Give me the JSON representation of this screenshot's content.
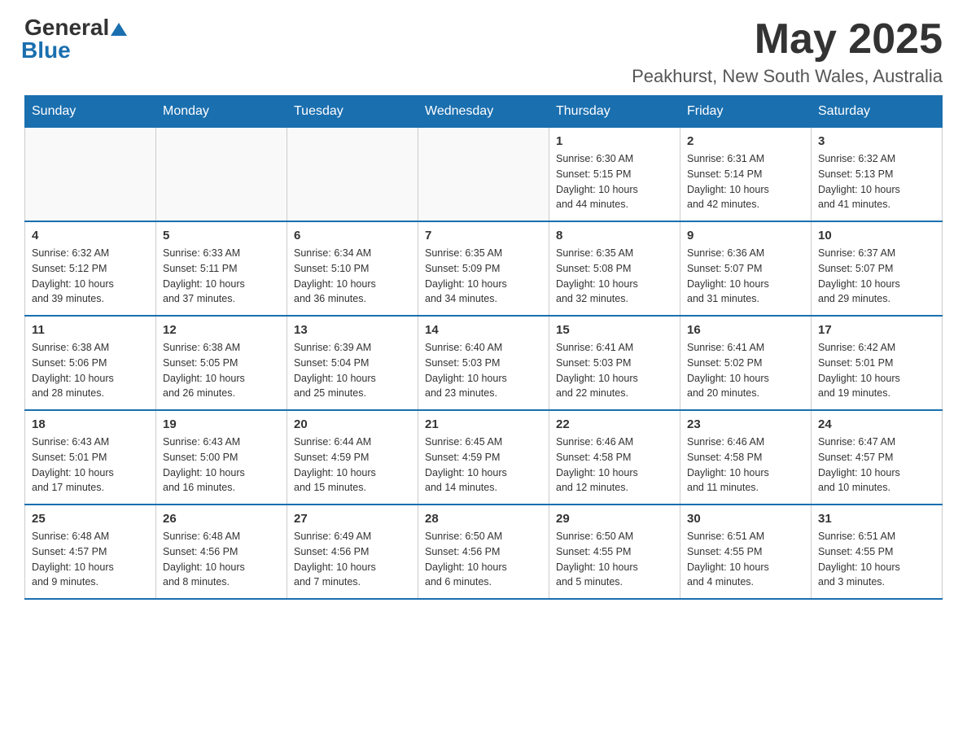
{
  "header": {
    "logo_general": "General",
    "logo_blue": "Blue",
    "month_title": "May 2025",
    "location": "Peakhurst, New South Wales, Australia"
  },
  "days_of_week": [
    "Sunday",
    "Monday",
    "Tuesday",
    "Wednesday",
    "Thursday",
    "Friday",
    "Saturday"
  ],
  "weeks": [
    [
      {
        "day": "",
        "info": ""
      },
      {
        "day": "",
        "info": ""
      },
      {
        "day": "",
        "info": ""
      },
      {
        "day": "",
        "info": ""
      },
      {
        "day": "1",
        "info": "Sunrise: 6:30 AM\nSunset: 5:15 PM\nDaylight: 10 hours\nand 44 minutes."
      },
      {
        "day": "2",
        "info": "Sunrise: 6:31 AM\nSunset: 5:14 PM\nDaylight: 10 hours\nand 42 minutes."
      },
      {
        "day": "3",
        "info": "Sunrise: 6:32 AM\nSunset: 5:13 PM\nDaylight: 10 hours\nand 41 minutes."
      }
    ],
    [
      {
        "day": "4",
        "info": "Sunrise: 6:32 AM\nSunset: 5:12 PM\nDaylight: 10 hours\nand 39 minutes."
      },
      {
        "day": "5",
        "info": "Sunrise: 6:33 AM\nSunset: 5:11 PM\nDaylight: 10 hours\nand 37 minutes."
      },
      {
        "day": "6",
        "info": "Sunrise: 6:34 AM\nSunset: 5:10 PM\nDaylight: 10 hours\nand 36 minutes."
      },
      {
        "day": "7",
        "info": "Sunrise: 6:35 AM\nSunset: 5:09 PM\nDaylight: 10 hours\nand 34 minutes."
      },
      {
        "day": "8",
        "info": "Sunrise: 6:35 AM\nSunset: 5:08 PM\nDaylight: 10 hours\nand 32 minutes."
      },
      {
        "day": "9",
        "info": "Sunrise: 6:36 AM\nSunset: 5:07 PM\nDaylight: 10 hours\nand 31 minutes."
      },
      {
        "day": "10",
        "info": "Sunrise: 6:37 AM\nSunset: 5:07 PM\nDaylight: 10 hours\nand 29 minutes."
      }
    ],
    [
      {
        "day": "11",
        "info": "Sunrise: 6:38 AM\nSunset: 5:06 PM\nDaylight: 10 hours\nand 28 minutes."
      },
      {
        "day": "12",
        "info": "Sunrise: 6:38 AM\nSunset: 5:05 PM\nDaylight: 10 hours\nand 26 minutes."
      },
      {
        "day": "13",
        "info": "Sunrise: 6:39 AM\nSunset: 5:04 PM\nDaylight: 10 hours\nand 25 minutes."
      },
      {
        "day": "14",
        "info": "Sunrise: 6:40 AM\nSunset: 5:03 PM\nDaylight: 10 hours\nand 23 minutes."
      },
      {
        "day": "15",
        "info": "Sunrise: 6:41 AM\nSunset: 5:03 PM\nDaylight: 10 hours\nand 22 minutes."
      },
      {
        "day": "16",
        "info": "Sunrise: 6:41 AM\nSunset: 5:02 PM\nDaylight: 10 hours\nand 20 minutes."
      },
      {
        "day": "17",
        "info": "Sunrise: 6:42 AM\nSunset: 5:01 PM\nDaylight: 10 hours\nand 19 minutes."
      }
    ],
    [
      {
        "day": "18",
        "info": "Sunrise: 6:43 AM\nSunset: 5:01 PM\nDaylight: 10 hours\nand 17 minutes."
      },
      {
        "day": "19",
        "info": "Sunrise: 6:43 AM\nSunset: 5:00 PM\nDaylight: 10 hours\nand 16 minutes."
      },
      {
        "day": "20",
        "info": "Sunrise: 6:44 AM\nSunset: 4:59 PM\nDaylight: 10 hours\nand 15 minutes."
      },
      {
        "day": "21",
        "info": "Sunrise: 6:45 AM\nSunset: 4:59 PM\nDaylight: 10 hours\nand 14 minutes."
      },
      {
        "day": "22",
        "info": "Sunrise: 6:46 AM\nSunset: 4:58 PM\nDaylight: 10 hours\nand 12 minutes."
      },
      {
        "day": "23",
        "info": "Sunrise: 6:46 AM\nSunset: 4:58 PM\nDaylight: 10 hours\nand 11 minutes."
      },
      {
        "day": "24",
        "info": "Sunrise: 6:47 AM\nSunset: 4:57 PM\nDaylight: 10 hours\nand 10 minutes."
      }
    ],
    [
      {
        "day": "25",
        "info": "Sunrise: 6:48 AM\nSunset: 4:57 PM\nDaylight: 10 hours\nand 9 minutes."
      },
      {
        "day": "26",
        "info": "Sunrise: 6:48 AM\nSunset: 4:56 PM\nDaylight: 10 hours\nand 8 minutes."
      },
      {
        "day": "27",
        "info": "Sunrise: 6:49 AM\nSunset: 4:56 PM\nDaylight: 10 hours\nand 7 minutes."
      },
      {
        "day": "28",
        "info": "Sunrise: 6:50 AM\nSunset: 4:56 PM\nDaylight: 10 hours\nand 6 minutes."
      },
      {
        "day": "29",
        "info": "Sunrise: 6:50 AM\nSunset: 4:55 PM\nDaylight: 10 hours\nand 5 minutes."
      },
      {
        "day": "30",
        "info": "Sunrise: 6:51 AM\nSunset: 4:55 PM\nDaylight: 10 hours\nand 4 minutes."
      },
      {
        "day": "31",
        "info": "Sunrise: 6:51 AM\nSunset: 4:55 PM\nDaylight: 10 hours\nand 3 minutes."
      }
    ]
  ]
}
